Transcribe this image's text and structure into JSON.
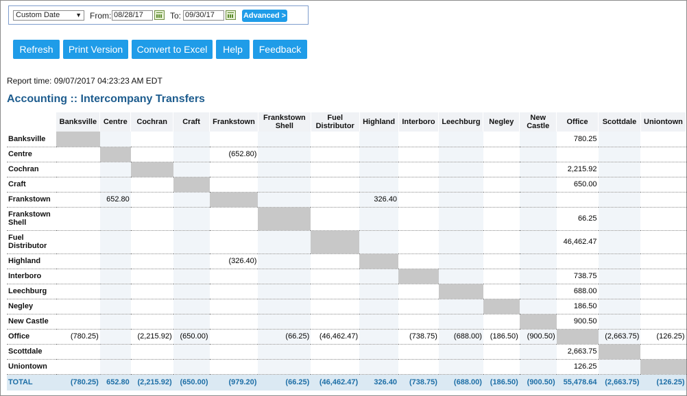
{
  "filter": {
    "range_select": "Custom Date",
    "from_label": "From:",
    "from_value": "08/28/17",
    "to_label": "To:",
    "to_value": "09/30/17",
    "advanced_label": "Advanced >"
  },
  "toolbar": {
    "refresh": "Refresh",
    "print": "Print Version",
    "excel": "Convert to Excel",
    "help": "Help",
    "feedback": "Feedback"
  },
  "report_time": "Report time: 09/07/2017 04:23:23 AM EDT",
  "page_title": "Accounting :: Intercompany Transfers",
  "colors": {
    "accent": "#1f9ce8",
    "title": "#1d5c8e",
    "diagonal": "#c8c8c8",
    "total_bg": "#dbe9f3"
  },
  "columns": [
    "Banksville",
    "Centre",
    "Cochran",
    "Craft",
    "Frankstown",
    "Frankstown Shell",
    "Fuel Distributor",
    "Highland",
    "Interboro",
    "Leechburg",
    "Negley",
    "New Castle",
    "Office",
    "Scottdale",
    "Uniontown"
  ],
  "rows": [
    {
      "label": "Banksville",
      "cells": [
        "",
        "",
        "",
        "",
        "",
        "",
        "",
        "",
        "",
        "",
        "",
        "",
        "780.25",
        "",
        ""
      ]
    },
    {
      "label": "Centre",
      "cells": [
        "",
        "",
        "",
        "",
        "(652.80)",
        "",
        "",
        "",
        "",
        "",
        "",
        "",
        "",
        "",
        ""
      ]
    },
    {
      "label": "Cochran",
      "cells": [
        "",
        "",
        "",
        "",
        "",
        "",
        "",
        "",
        "",
        "",
        "",
        "",
        "2,215.92",
        "",
        ""
      ]
    },
    {
      "label": "Craft",
      "cells": [
        "",
        "",
        "",
        "",
        "",
        "",
        "",
        "",
        "",
        "",
        "",
        "",
        "650.00",
        "",
        ""
      ]
    },
    {
      "label": "Frankstown",
      "cells": [
        "",
        "652.80",
        "",
        "",
        "",
        "",
        "",
        "326.40",
        "",
        "",
        "",
        "",
        "",
        "",
        ""
      ]
    },
    {
      "label": "Frankstown Shell",
      "cells": [
        "",
        "",
        "",
        "",
        "",
        "",
        "",
        "",
        "",
        "",
        "",
        "",
        "66.25",
        "",
        ""
      ]
    },
    {
      "label": "Fuel Distributor",
      "cells": [
        "",
        "",
        "",
        "",
        "",
        "",
        "",
        "",
        "",
        "",
        "",
        "",
        "46,462.47",
        "",
        ""
      ]
    },
    {
      "label": "Highland",
      "cells": [
        "",
        "",
        "",
        "",
        "(326.40)",
        "",
        "",
        "",
        "",
        "",
        "",
        "",
        "",
        "",
        ""
      ]
    },
    {
      "label": "Interboro",
      "cells": [
        "",
        "",
        "",
        "",
        "",
        "",
        "",
        "",
        "",
        "",
        "",
        "",
        "738.75",
        "",
        ""
      ]
    },
    {
      "label": "Leechburg",
      "cells": [
        "",
        "",
        "",
        "",
        "",
        "",
        "",
        "",
        "",
        "",
        "",
        "",
        "688.00",
        "",
        ""
      ]
    },
    {
      "label": "Negley",
      "cells": [
        "",
        "",
        "",
        "",
        "",
        "",
        "",
        "",
        "",
        "",
        "",
        "",
        "186.50",
        "",
        ""
      ]
    },
    {
      "label": "New Castle",
      "cells": [
        "",
        "",
        "",
        "",
        "",
        "",
        "",
        "",
        "",
        "",
        "",
        "",
        "900.50",
        "",
        ""
      ]
    },
    {
      "label": "Office",
      "cells": [
        "(780.25)",
        "",
        "(2,215.92)",
        "(650.00)",
        "",
        "(66.25)",
        "(46,462.47)",
        "",
        "(738.75)",
        "(688.00)",
        "(186.50)",
        "(900.50)",
        "",
        "(2,663.75)",
        "(126.25)"
      ]
    },
    {
      "label": "Scottdale",
      "cells": [
        "",
        "",
        "",
        "",
        "",
        "",
        "",
        "",
        "",
        "",
        "",
        "",
        "2,663.75",
        "",
        ""
      ]
    },
    {
      "label": "Uniontown",
      "cells": [
        "",
        "",
        "",
        "",
        "",
        "",
        "",
        "",
        "",
        "",
        "",
        "",
        "126.25",
        "",
        ""
      ]
    }
  ],
  "total": {
    "label": "TOTAL",
    "cells": [
      "(780.25)",
      "652.80",
      "(2,215.92)",
      "(650.00)",
      "(979.20)",
      "(66.25)",
      "(46,462.47)",
      "326.40",
      "(738.75)",
      "(688.00)",
      "(186.50)",
      "(900.50)",
      "55,478.64",
      "(2,663.75)",
      "(126.25)"
    ]
  }
}
